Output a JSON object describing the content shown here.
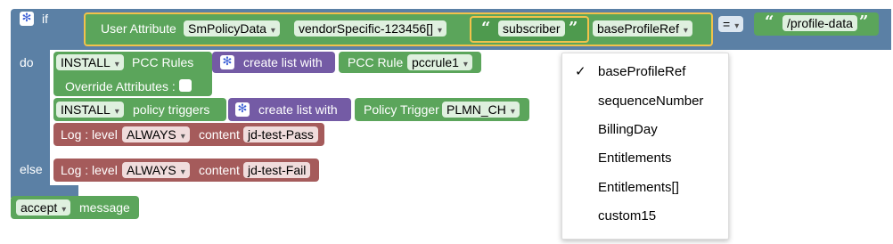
{
  "if_block": {
    "keyword_if": "if",
    "keyword_do": "do",
    "keyword_else": "else",
    "user_attribute_label": "User Attribute",
    "sm_policy_data": "SmPolicyData",
    "vendor_specific": "vendorSpecific-123456[]",
    "subscriber": "subscriber",
    "base_profile_ref": "baseProfileRef",
    "operator": "=",
    "profile_data": "/profile-data"
  },
  "pcc_rules_block": {
    "action": "INSTALL",
    "label": "PCC Rules",
    "override_label": "Override Attributes :",
    "create_list_label": "create list with",
    "pcc_rule_label": "PCC Rule",
    "pcc_rule_value": "pccrule1"
  },
  "policy_triggers_block": {
    "action": "INSTALL",
    "label": "policy triggers",
    "create_list_label": "create list with",
    "trigger_label": "Policy Trigger",
    "trigger_value": "PLMN_CH"
  },
  "log_pass": {
    "prefix": "Log : level",
    "level": "ALWAYS",
    "content_label": "content",
    "content_value": "jd-test-Pass"
  },
  "log_fail": {
    "prefix": "Log : level",
    "level": "ALWAYS",
    "content_label": "content",
    "content_value": "jd-test-Fail"
  },
  "accept_block": {
    "value": "accept",
    "label": "message"
  },
  "dropdown_menu": {
    "selected_mark": "✓",
    "items": [
      "baseProfileRef",
      "sequenceNumber",
      "BillingDay",
      "Entitlements",
      "Entitlements[]",
      "custom15"
    ]
  },
  "colors": {
    "logic_blue": "#5b80a5",
    "action_green": "#5ba55b",
    "list_purple": "#745ba5",
    "log_red": "#a55b5b",
    "highlight_yellow": "#f2c24b"
  }
}
